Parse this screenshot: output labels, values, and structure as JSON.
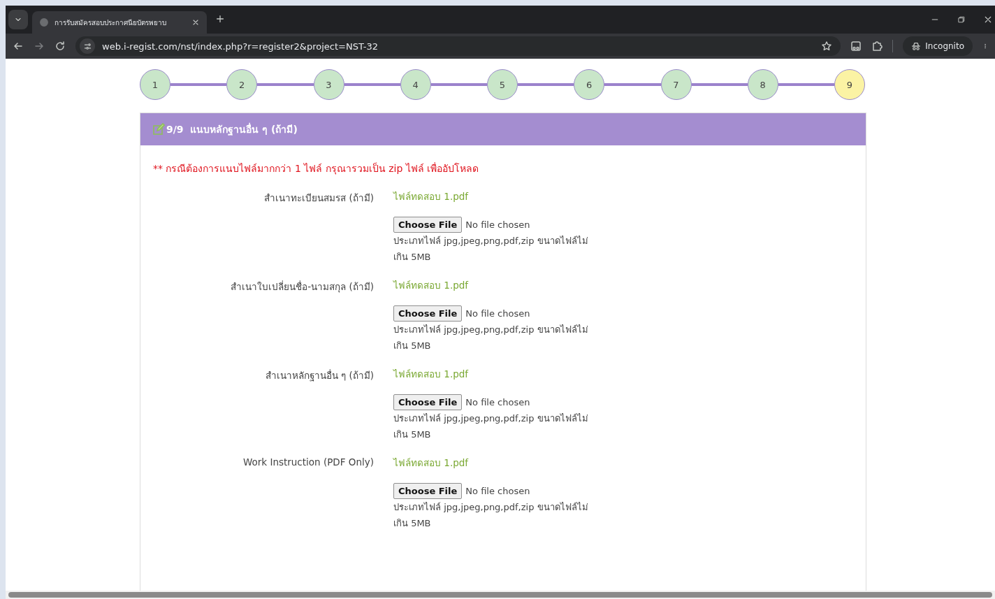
{
  "browser": {
    "tab_title": "การรับสมัครสอบประกาศนียบัตรพยาบ",
    "url": "web.i-regist.com/nst/index.php?r=register2&project=NST-32",
    "forward_disabled": true,
    "profile_label": "Incognito"
  },
  "steps": [
    {
      "label": "1",
      "current": false
    },
    {
      "label": "2",
      "current": false
    },
    {
      "label": "3",
      "current": false
    },
    {
      "label": "4",
      "current": false
    },
    {
      "label": "5",
      "current": false
    },
    {
      "label": "6",
      "current": false
    },
    {
      "label": "7",
      "current": false
    },
    {
      "label": "8",
      "current": false
    },
    {
      "label": "9",
      "current": true
    }
  ],
  "card": {
    "title": "9/9  แนบหลักฐานอื่น ๆ (ถ้ามี)",
    "note": "** กรณีต้องการแนบไฟล์มากกว่า 1 ไฟล์ กรุณารวมเป็น zip ไฟล์ เพื่ออัปโหลด",
    "fields": [
      {
        "label": "สำเนาทะเบียนสมรส (ถ้ามี)",
        "current_file": "ไฟล์ทดสอบ 1.pdf",
        "button": "Choose File",
        "status": "No file chosen",
        "hint": "ประเภทไฟล์ jpg,jpeg,png,pdf,zip ขนาดไฟล์ไม่ เกิน 5MB"
      },
      {
        "label": "สำเนาใบเปลี่ยนชื่อ-นามสกุล (ถ้ามี)",
        "current_file": "ไฟล์ทดสอบ 1.pdf",
        "button": "Choose File",
        "status": "No file chosen",
        "hint": "ประเภทไฟล์ jpg,jpeg,png,pdf,zip ขนาดไฟล์ไม่ เกิน 5MB"
      },
      {
        "label": "สำเนาหลักฐานอื่น ๆ (ถ้ามี)",
        "current_file": "ไฟล์ทดสอบ 1.pdf",
        "button": "Choose File",
        "status": "No file chosen",
        "hint": "ประเภทไฟล์ jpg,jpeg,png,pdf,zip ขนาดไฟล์ไม่ เกิน 5MB"
      },
      {
        "label": "Work Instruction (PDF Only)",
        "current_file": "ไฟล์ทดสอบ 1.pdf",
        "button": "Choose File",
        "status": "No file chosen",
        "hint": "ประเภทไฟล์ jpg,jpeg,png,pdf,zip ขนาดไฟล์ไม่ เกิน 5MB"
      }
    ]
  }
}
